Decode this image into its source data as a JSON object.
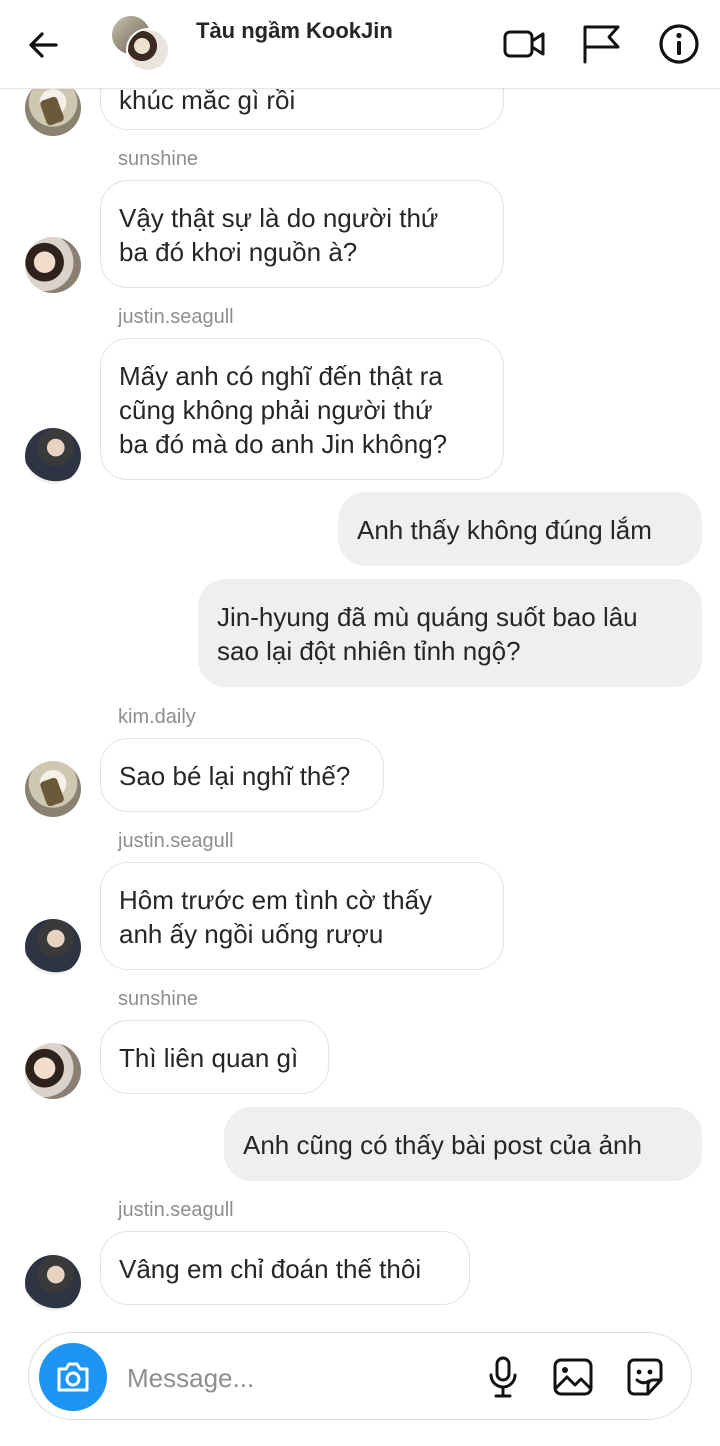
{
  "header": {
    "title": "Tàu ngầm KookJin",
    "back_icon": "arrow-left-icon",
    "video_icon": "video-camera-icon",
    "report_icon": "flag-icon",
    "info_icon": "info-icon"
  },
  "messages": [
    {
      "kind": "in",
      "sender": "",
      "text": "khúc mắc gì rồi",
      "avatar": "kim.daily"
    },
    {
      "kind": "in",
      "sender": "sunshine",
      "lines": [
        "Vậy thật sự là do người thứ",
        "ba đó khơi nguồn à?"
      ]
    },
    {
      "kind": "in",
      "sender": "justin.seagull",
      "lines": [
        "Mấy anh có nghĩ đến thật ra",
        "cũng không phải người thứ",
        "ba đó mà do anh Jin không?"
      ]
    },
    {
      "kind": "out",
      "lines": [
        "Anh thấy không đúng lắm"
      ]
    },
    {
      "kind": "out",
      "lines": [
        "Jin-hyung đã mù quáng suốt bao lâu",
        "sao lại đột nhiên tỉnh ngộ?"
      ]
    },
    {
      "kind": "in",
      "sender": "kim.daily",
      "lines": [
        "Sao bé lại nghĩ thế?"
      ]
    },
    {
      "kind": "in",
      "sender": "justin.seagull",
      "lines": [
        "Hôm trước em tình cờ thấy",
        "anh ấy ngồi uống rượu"
      ]
    },
    {
      "kind": "in",
      "sender": "sunshine",
      "lines": [
        "Thì liên quan gì"
      ]
    },
    {
      "kind": "out",
      "lines": [
        "Anh cũng có thấy bài post của ảnh"
      ]
    },
    {
      "kind": "in",
      "sender": "justin.seagull",
      "lines": [
        "Vâng em chỉ đoán thế thôi"
      ]
    }
  ],
  "composer": {
    "placeholder": "Message...",
    "camera_icon": "camera-icon",
    "mic_icon": "microphone-icon",
    "gallery_icon": "image-icon",
    "sticker_icon": "sticker-icon"
  },
  "colors": {
    "accent": "#1e95f2",
    "outgoing_bubble": "#efefef",
    "sender_name": "#8e8e8e"
  }
}
